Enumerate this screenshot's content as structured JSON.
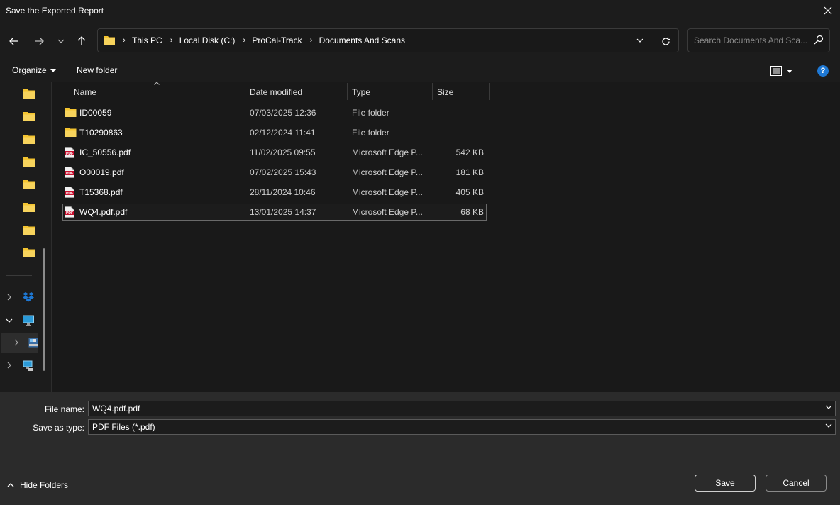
{
  "window": {
    "title": "Save the Exported Report"
  },
  "address": {
    "crumbs": [
      "This PC",
      "Local Disk (C:)",
      "ProCal-Track",
      "Documents And Scans"
    ]
  },
  "search": {
    "placeholder": "Search Documents And Sca..."
  },
  "toolbar": {
    "organize_label": "Organize",
    "new_folder_label": "New folder",
    "help_label": "?"
  },
  "columns": {
    "name": "Name",
    "date": "Date modified",
    "type": "Type",
    "size": "Size"
  },
  "files": [
    {
      "kind": "folder",
      "name": "ID00059",
      "date": "07/03/2025 12:36",
      "type": "File folder",
      "size": ""
    },
    {
      "kind": "folder",
      "name": "T10290863",
      "date": "02/12/2024 11:41",
      "type": "File folder",
      "size": ""
    },
    {
      "kind": "pdf",
      "name": "IC_50556.pdf",
      "date": "11/02/2025 09:55",
      "type": "Microsoft Edge P...",
      "size": "542 KB"
    },
    {
      "kind": "pdf",
      "name": "O00019.pdf",
      "date": "07/02/2025 15:43",
      "type": "Microsoft Edge P...",
      "size": "181 KB"
    },
    {
      "kind": "pdf",
      "name": "T15368.pdf",
      "date": "28/11/2024 10:46",
      "type": "Microsoft Edge P...",
      "size": "405 KB"
    },
    {
      "kind": "pdf",
      "name": "WQ4.pdf.pdf",
      "date": "13/01/2025 14:37",
      "type": "Microsoft Edge P...",
      "size": "68 KB"
    }
  ],
  "form": {
    "filename_label": "File name:",
    "filename_value": "WQ4.pdf.pdf",
    "type_label": "Save as type:",
    "type_value": "PDF Files (*.pdf)"
  },
  "footer": {
    "hide_folders_label": "Hide Folders",
    "save_label": "Save",
    "cancel_label": "Cancel"
  },
  "colors": {
    "folder": "#f4c430",
    "pdf": "#c8102e",
    "accent": "#1e78d4"
  }
}
